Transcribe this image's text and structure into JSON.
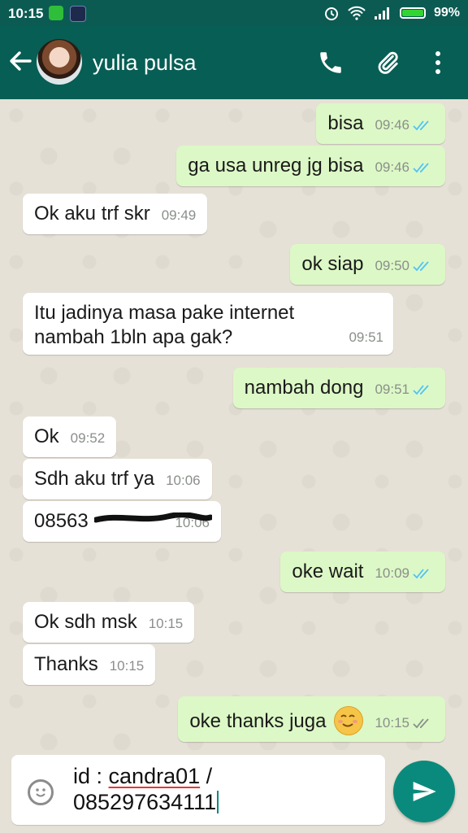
{
  "status_bar": {
    "time": "10:15",
    "battery": "99%"
  },
  "header": {
    "contact_name": "yulia pulsa",
    "icons": [
      "back-arrow-icon",
      "avatar",
      "phone-icon",
      "paperclip-icon",
      "more-vert-icon"
    ]
  },
  "messages": [
    {
      "dir": "out",
      "text": "bisa",
      "time": "09:46",
      "ticks": "read"
    },
    {
      "dir": "out",
      "text": "ga usa unreg jg bisa",
      "time": "09:46",
      "ticks": "read"
    },
    {
      "dir": "in",
      "text": "Ok aku trf skr",
      "time": "09:49"
    },
    {
      "dir": "out",
      "text": "ok siap",
      "time": "09:50",
      "ticks": "read"
    },
    {
      "dir": "in",
      "text_line1": "Itu jadinya masa pake internet",
      "text_line2": "nambah 1bln apa gak?",
      "time": "09:51"
    },
    {
      "dir": "out",
      "text": "nambah dong",
      "time": "09:51",
      "ticks": "read"
    },
    {
      "dir": "in",
      "text": "Ok",
      "time": "09:52"
    },
    {
      "dir": "in",
      "text": "Sdh aku trf ya",
      "time": "10:06"
    },
    {
      "dir": "in",
      "text": "08563",
      "time": "10:06",
      "redacted": true
    },
    {
      "dir": "out",
      "text": "oke wait",
      "time": "10:09",
      "ticks": "read"
    },
    {
      "dir": "in",
      "text": "Ok sdh msk",
      "time": "10:15"
    },
    {
      "dir": "in",
      "text": "Thanks",
      "time": "10:15"
    },
    {
      "dir": "out",
      "text": "oke thanks juga",
      "time": "10:15",
      "ticks": "delivered",
      "emoji": "relieved-face-icon"
    }
  ],
  "composer": {
    "line1_prefix": "id : ",
    "line1_word": "candra01",
    "line1_suffix": " /",
    "line2": "085297634111"
  },
  "colors": {
    "header": "#075e54",
    "status_bar": "#0b5b53",
    "outgoing_bubble": "#dcf8c6",
    "incoming_bubble": "#ffffff",
    "read_tick": "#4fc3f7",
    "send_button": "#0a8a7c"
  }
}
